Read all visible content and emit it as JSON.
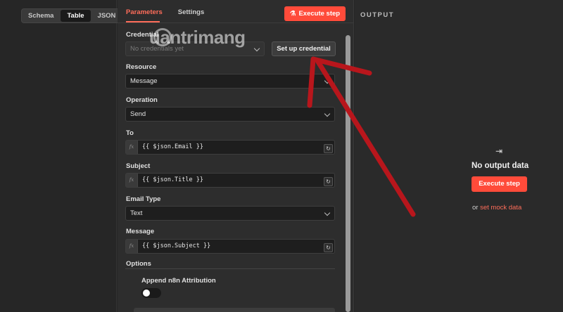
{
  "left": {
    "view_tabs": [
      "Schema",
      "Table",
      "JSON"
    ],
    "active_view": "Table"
  },
  "params": {
    "tabs": [
      "Parameters",
      "Settings"
    ],
    "active_tab": "Parameters",
    "execute_label": "Execute step",
    "credential": {
      "label": "Credential",
      "placeholder": "No credentials yet",
      "setup_label": "Set up credential"
    },
    "resource": {
      "label": "Resource",
      "value": "Message"
    },
    "operation": {
      "label": "Operation",
      "value": "Send"
    },
    "to": {
      "label": "To",
      "value": "{{ $json.Email }}"
    },
    "subject": {
      "label": "Subject",
      "value": "{{ $json.Title }}"
    },
    "email_type": {
      "label": "Email Type",
      "value": "Text"
    },
    "message": {
      "label": "Message",
      "value": "{{ $json.Subject }}"
    },
    "options_label": "Options",
    "append_attribution": {
      "label": "Append n8n Attribution",
      "enabled": false
    }
  },
  "output": {
    "title": "OUTPUT",
    "empty_text": "No output data",
    "execute_label": "Execute step",
    "mock_prefix": "or",
    "mock_link": "set mock data"
  },
  "watermark": {
    "text": "uantrimang"
  },
  "colors": {
    "accent": "#ff6d5a",
    "execute_button": "#ff4b3a",
    "annotation_arrow": "#b8161c"
  },
  "icons": {
    "execute": "flask-icon",
    "expand": "expand-icon",
    "no_output": "arrow-to-bar-icon",
    "fx": "function-icon"
  }
}
